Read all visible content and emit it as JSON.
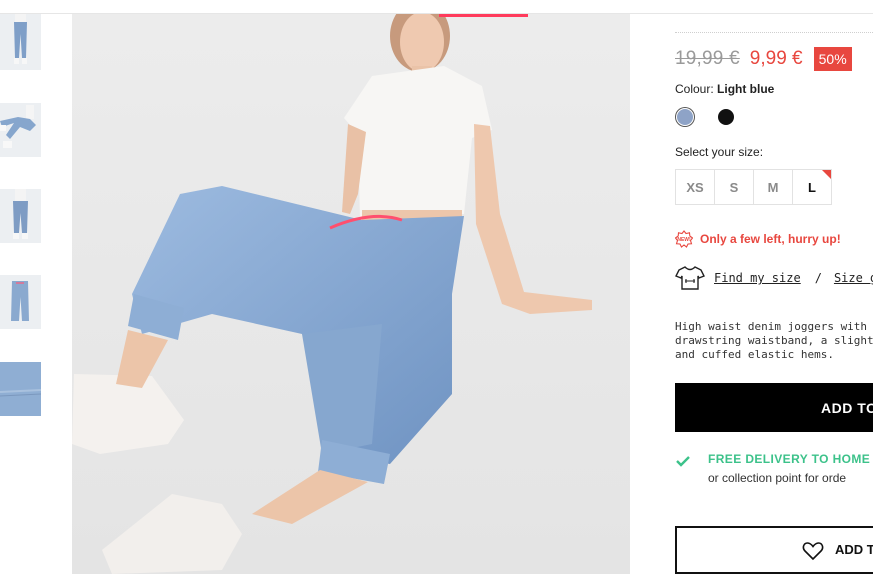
{
  "gallery": {
    "thumbnails": [
      {
        "alt": "thumbnail-front"
      },
      {
        "alt": "thumbnail-sitting"
      },
      {
        "alt": "thumbnail-full"
      },
      {
        "alt": "thumbnail-back"
      },
      {
        "alt": "thumbnail-detail"
      }
    ]
  },
  "product": {
    "old_price": "19,99 €",
    "new_price": "9,99 €",
    "discount": "50%",
    "colour_label": "Colour:",
    "colour_value": "Light blue",
    "colours": [
      {
        "name": "Light blue",
        "hex": "#8ea3c7"
      },
      {
        "name": "Black",
        "hex": "#111111"
      }
    ],
    "size_label": "Select your size:",
    "sizes": [
      "XS",
      "S",
      "M",
      "L"
    ],
    "selected_size": "L",
    "hurry_text": "Only a few left, hurry up!",
    "hurry_badge": "NEW!",
    "find_size": "Find my size",
    "separator": "/",
    "size_guide": "Size guide",
    "description": "High waist denim joggers with two\ndrawstring waistband, a slightly lo\nand cuffed elastic hems.",
    "add_to_cart": "ADD TO",
    "delivery_title": "FREE DELIVERY TO HOME",
    "delivery_sub": "or collection point for orde",
    "wishlist": "ADD T"
  },
  "colors": {
    "sale": "#e8473f",
    "delivery": "#3cc28a",
    "accent": "#ff3b5c"
  }
}
